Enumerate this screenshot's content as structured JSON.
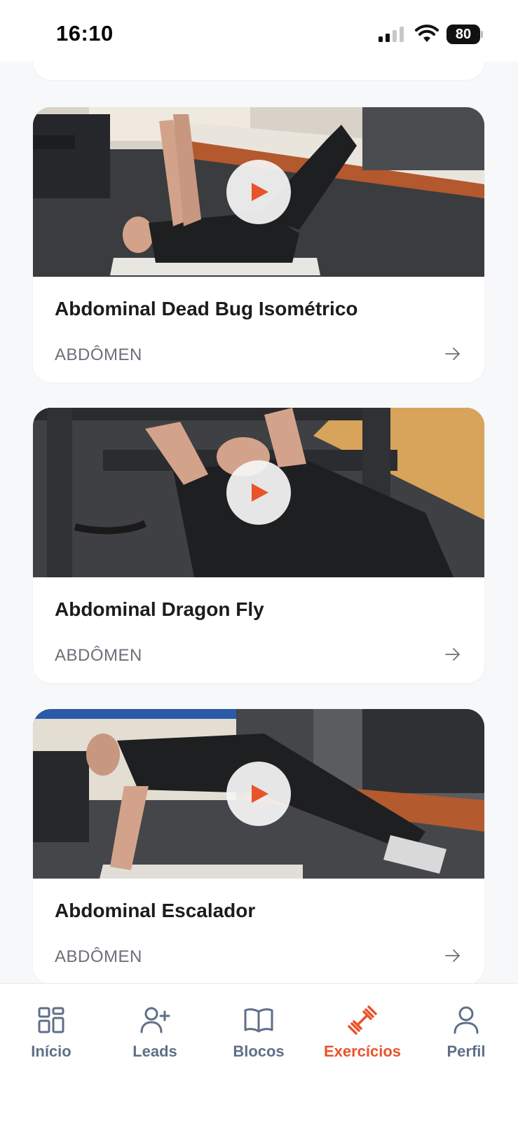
{
  "status_bar": {
    "time": "16:10",
    "battery": "80"
  },
  "exercises": [
    {
      "title": "Abdominal Dead Bug Isométrico",
      "category": "ABDÔMEN"
    },
    {
      "title": "Abdominal Dragon Fly",
      "category": "ABDÔMEN"
    },
    {
      "title": "Abdominal Escalador",
      "category": "ABDÔMEN"
    }
  ],
  "nav": {
    "items": [
      {
        "label": "Início",
        "icon": "grid-icon"
      },
      {
        "label": "Leads",
        "icon": "user-plus-icon"
      },
      {
        "label": "Blocos",
        "icon": "book-icon"
      },
      {
        "label": "Exercícios",
        "icon": "dumbbell-icon",
        "active": true
      },
      {
        "label": "Perfil",
        "icon": "user-icon"
      }
    ]
  },
  "colors": {
    "accent": "#e8542a",
    "nav_inactive": "#5f6f86",
    "background": "#f7f8fa"
  }
}
